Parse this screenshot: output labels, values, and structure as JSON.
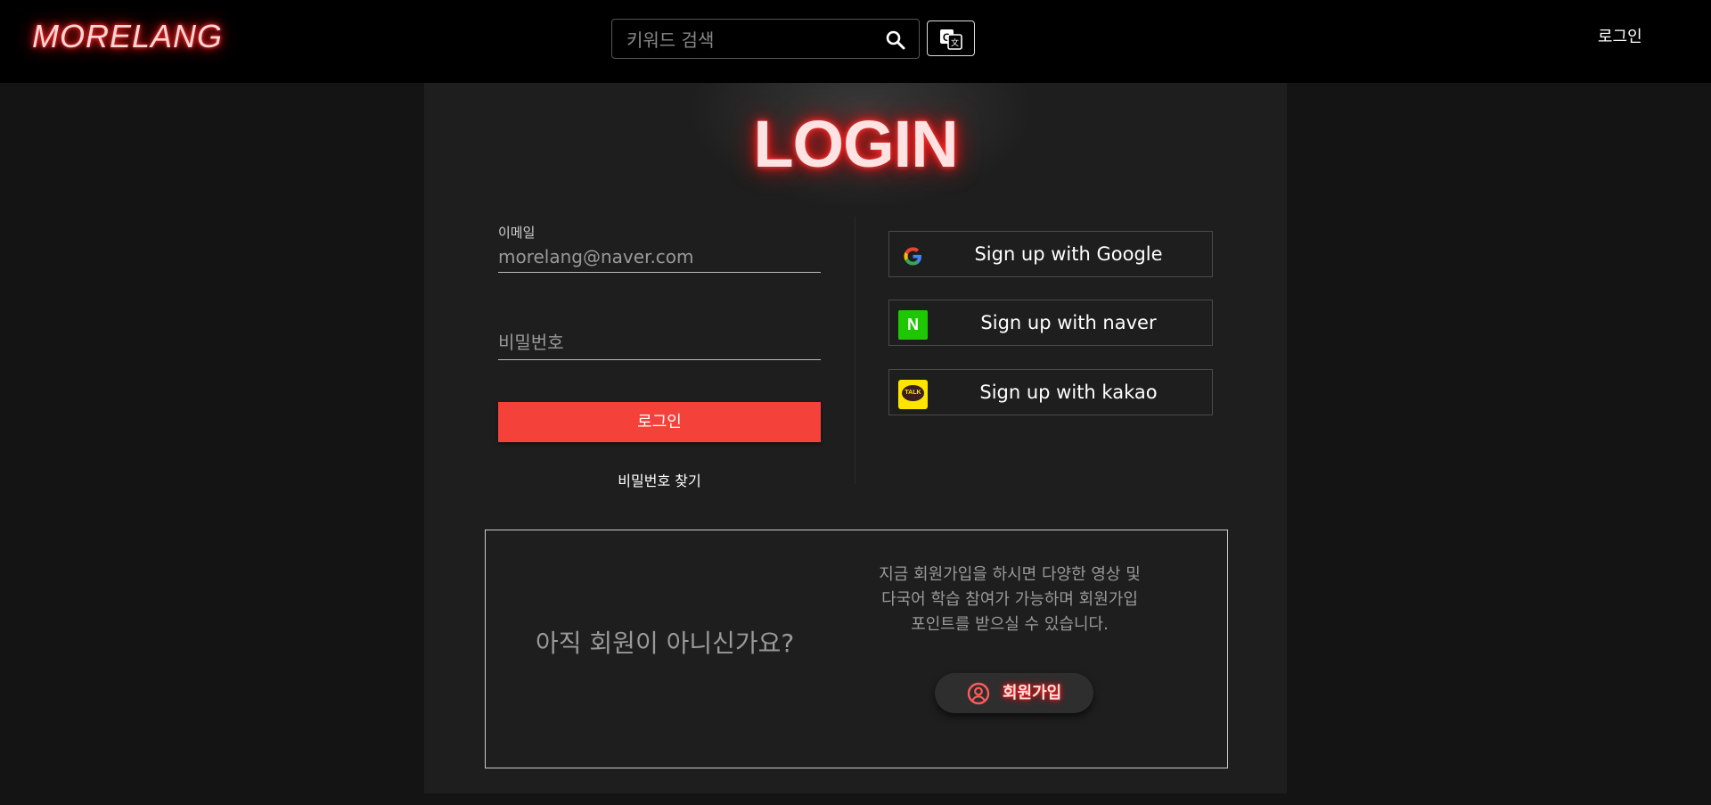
{
  "header": {
    "logo": "MORELANG",
    "search_placeholder": "키워드 검색",
    "login_link": "로그인"
  },
  "login": {
    "title": "LOGIN",
    "email_label": "이메일",
    "email_placeholder": "morelang@naver.com",
    "password_placeholder": "비밀번호",
    "login_button": "로그인",
    "find_password": "비밀번호 찾기"
  },
  "social": [
    {
      "label": "Sign up with Google",
      "icon": "google-icon"
    },
    {
      "label": "Sign up with naver",
      "icon": "naver-icon",
      "icon_text": "N"
    },
    {
      "label": "Sign up with kakao",
      "icon": "kakao-icon",
      "icon_text": "TALK"
    }
  ],
  "signup": {
    "question": "아직 회원이 아니신가요?",
    "description_lines": [
      "지금 회원가입을 하시면 다양한 영상 및",
      "다국어 학습 참여가 가능하며 회원가입",
      "포인트를 받으실 수 있습니다."
    ],
    "button": "회원가입"
  },
  "colors": {
    "accent": "#f4423b",
    "neon": "#ff2a2a",
    "naver": "#1ec800",
    "kakao": "#fee500"
  }
}
